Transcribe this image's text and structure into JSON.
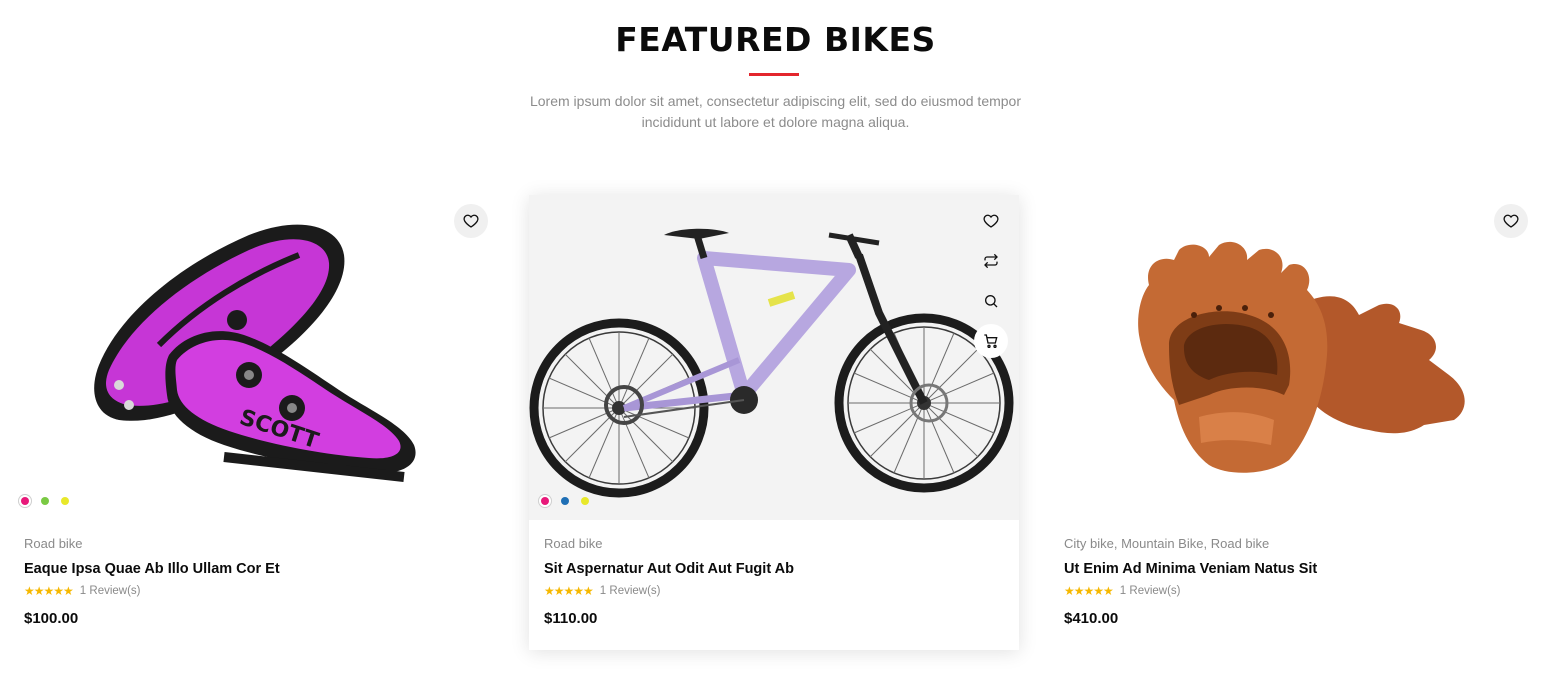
{
  "section": {
    "title": "FEATURED BIKES",
    "subtitle_line1": "Lorem ipsum dolor sit amet, consectetur adipiscing elit, sed do eiusmod tempor",
    "subtitle_line2": "incididunt ut labore et dolore magna aliqua.",
    "accent_color": "#e3262d"
  },
  "products": [
    {
      "categories": [
        "Road bike"
      ],
      "name": "Eaque Ipsa Quae Ab Illo Ullam Cor Et",
      "stars": "★★★★★",
      "reviews": "1 Review(s)",
      "price": "$100.00",
      "image": "pink-cycling-shoes",
      "swatches": [
        "#e8197a",
        "#7ac943",
        "#e8e82a"
      ],
      "selected_swatch": 0
    },
    {
      "categories": [
        "Road bike"
      ],
      "name": "Sit Aspernatur Aut Odit Aut Fugit Ab",
      "stars": "★★★★★",
      "reviews": "1 Review(s)",
      "price": "$110.00",
      "image": "purple-mountain-bike",
      "swatches": [
        "#e8197a",
        "#1f6fb5",
        "#e8e82a"
      ],
      "selected_swatch": 0
    },
    {
      "categories": [
        "City bike",
        "Mountain Bike",
        "Road bike"
      ],
      "name": "Ut Enim Ad Minima Veniam Natus Sit",
      "stars": "★★★★★",
      "reviews": "1 Review(s)",
      "price": "$410.00",
      "image": "leather-fingerless-gloves"
    }
  ],
  "icons": {
    "wishlist": "heart-icon",
    "compare": "compare-arrows-icon",
    "quickview": "search-icon",
    "cart": "cart-icon"
  }
}
